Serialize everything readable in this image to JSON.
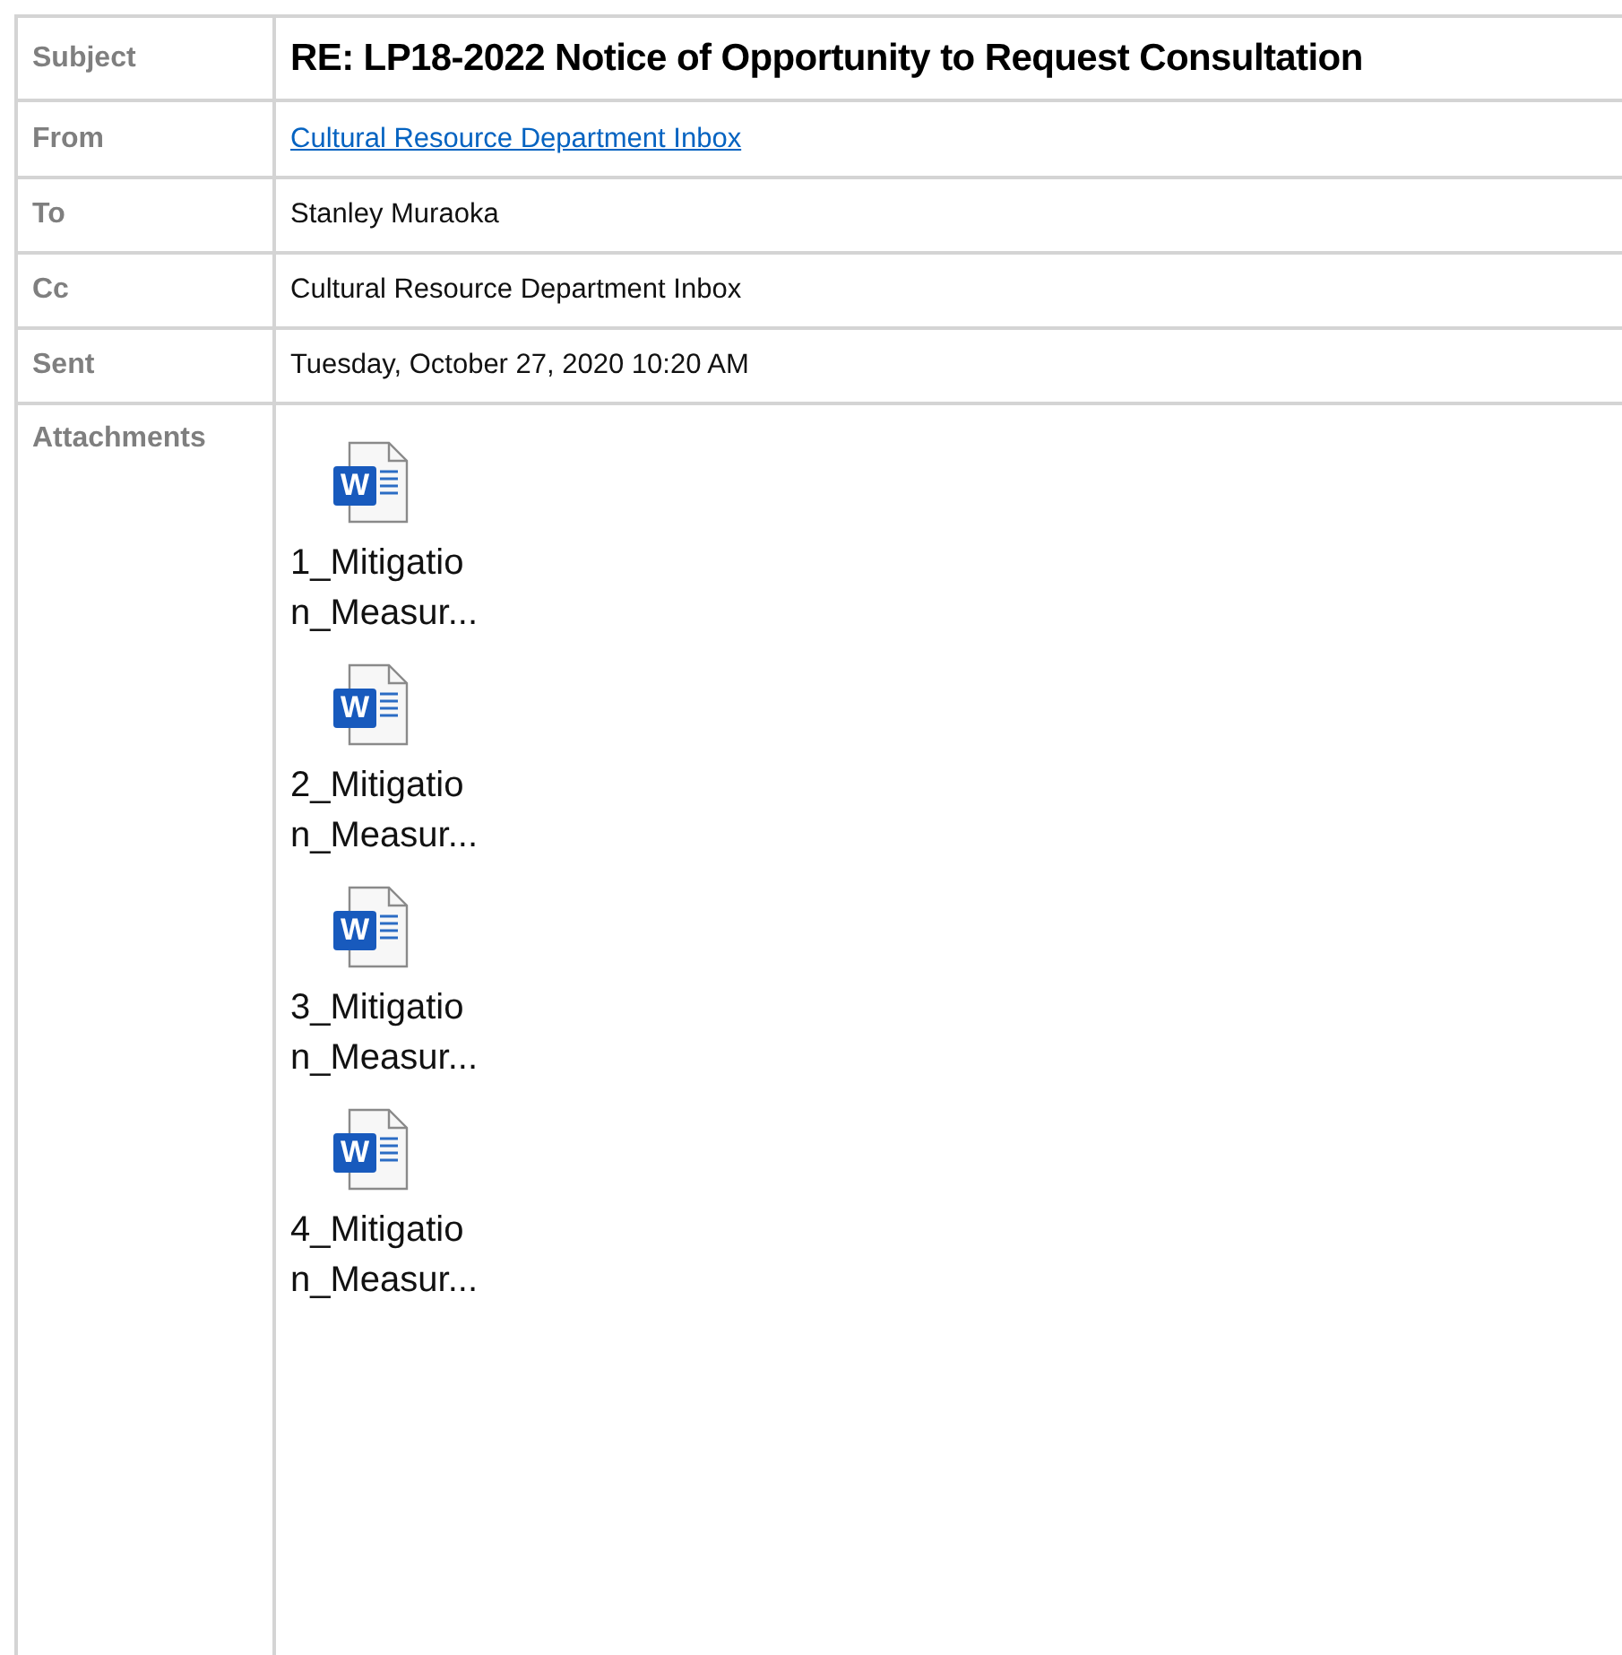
{
  "fields": [
    {
      "kind": "subject",
      "label": "Subject",
      "value": "RE: LP18-2022 Notice of Opportunity to Request Consultation"
    },
    {
      "kind": "link",
      "label": "From",
      "value": "Cultural Resource Department Inbox"
    },
    {
      "kind": "plain",
      "label": "To",
      "value": "Stanley Muraoka"
    },
    {
      "kind": "plain",
      "label": "Cc",
      "value": "Cultural Resource Department Inbox"
    },
    {
      "kind": "plain",
      "label": "Sent",
      "value": "Tuesday, October 27, 2020 10:20 AM"
    }
  ],
  "attachments": {
    "label": "Attachments",
    "items": [
      {
        "icon_letter": "W",
        "lines": [
          "1_Mitigatio",
          "n_Measur..."
        ]
      },
      {
        "icon_letter": "W",
        "lines": [
          "2_Mitigatio",
          "n_Measur..."
        ]
      },
      {
        "icon_letter": "W",
        "lines": [
          "3_Mitigatio",
          "n_Measur..."
        ]
      },
      {
        "icon_letter": "W",
        "lines": [
          "4_Mitigatio",
          "n_Measur..."
        ]
      }
    ]
  }
}
